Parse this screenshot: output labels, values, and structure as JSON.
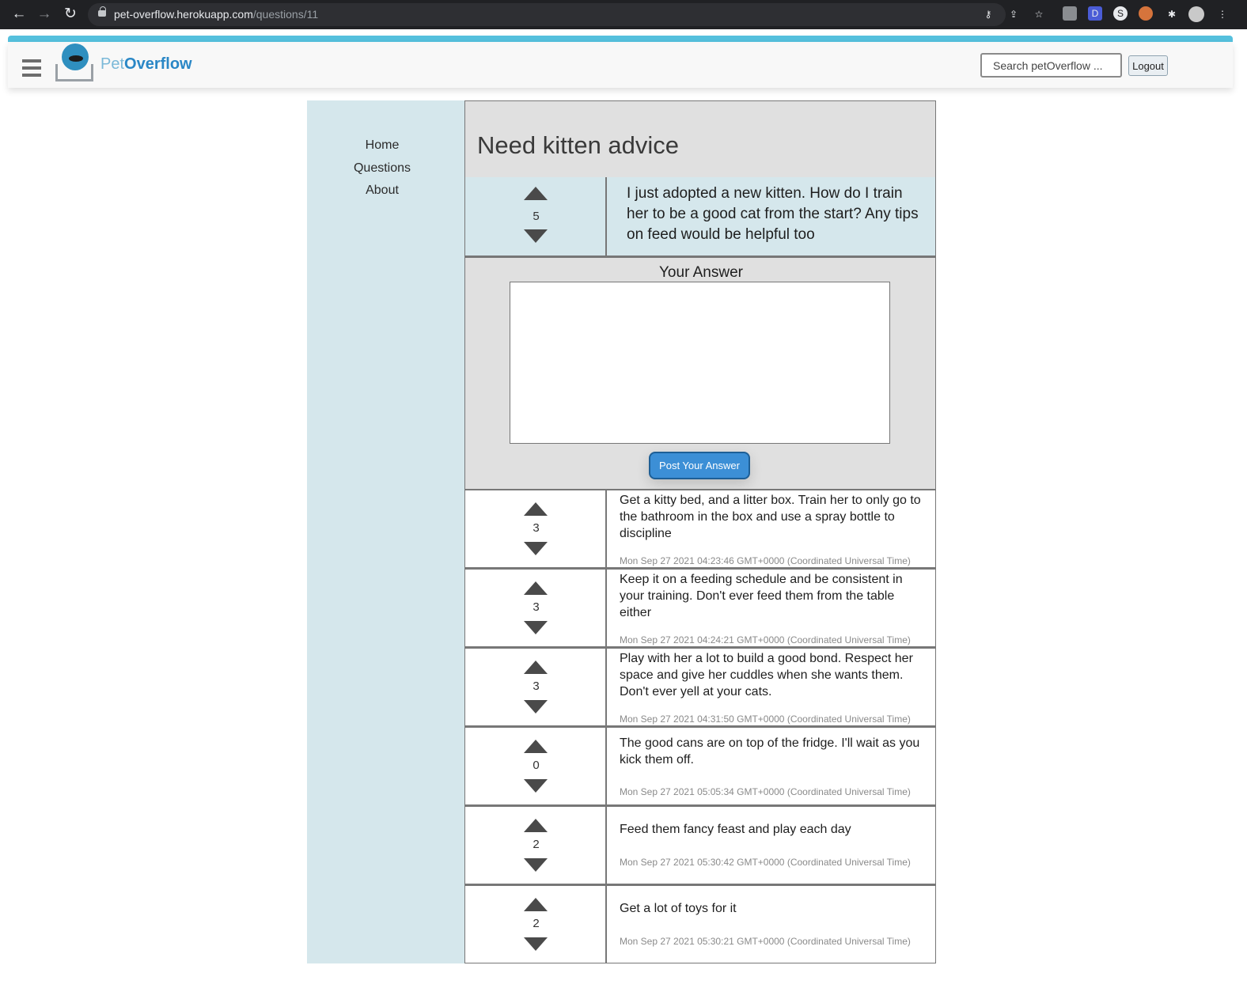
{
  "browser": {
    "url_domain": "pet-overflow.herokuapp.com",
    "url_path": "/questions/11"
  },
  "header": {
    "brand_pet": "Pet",
    "brand_overflow": "Overflow",
    "search_placeholder": "Search petOverflow ...",
    "logout_label": "Logout",
    "accent_color": "#55c0dd"
  },
  "sidebar": {
    "items": [
      {
        "label": "Home"
      },
      {
        "label": "Questions"
      },
      {
        "label": "About"
      }
    ]
  },
  "question": {
    "title": "Need kitten advice",
    "body": "I just adopted a new kitten. How do I train her to be a good cat from the start? Any tips on feed would be helpful too",
    "votes": "5"
  },
  "answer_form": {
    "heading": "Your Answer",
    "value": "",
    "submit_label": "Post Your Answer",
    "button_color": "#3c8fd6"
  },
  "answers": [
    {
      "votes": "3",
      "body": "Get a kitty bed, and a litter box. Train her to only go to the bathroom in the box and use a spray bottle to discipline",
      "date": "Mon Sep 27 2021 04:23:46 GMT+0000 (Coordinated Universal Time)"
    },
    {
      "votes": "3",
      "body": "Keep it on a feeding schedule and be consistent in your training. Don't ever feed them from the table either",
      "date": "Mon Sep 27 2021 04:24:21 GMT+0000 (Coordinated Universal Time)"
    },
    {
      "votes": "3",
      "body": "Play with her a lot to build a good bond. Respect her space and give her cuddles when she wants them. Don't ever yell at your cats.",
      "date": "Mon Sep 27 2021 04:31:50 GMT+0000 (Coordinated Universal Time)"
    },
    {
      "votes": "0",
      "body": "The good cans are on top of the fridge. I'll wait as you kick them off.",
      "date": "Mon Sep 27 2021 05:05:34 GMT+0000 (Coordinated Universal Time)"
    },
    {
      "votes": "2",
      "body": "Feed them fancy feast and play each day",
      "date": "Mon Sep 27 2021 05:30:42 GMT+0000 (Coordinated Universal Time)"
    },
    {
      "votes": "2",
      "body": "Get a lot of toys for it",
      "date": "Mon Sep 27 2021 05:30:21 GMT+0000 (Coordinated Universal Time)"
    }
  ]
}
